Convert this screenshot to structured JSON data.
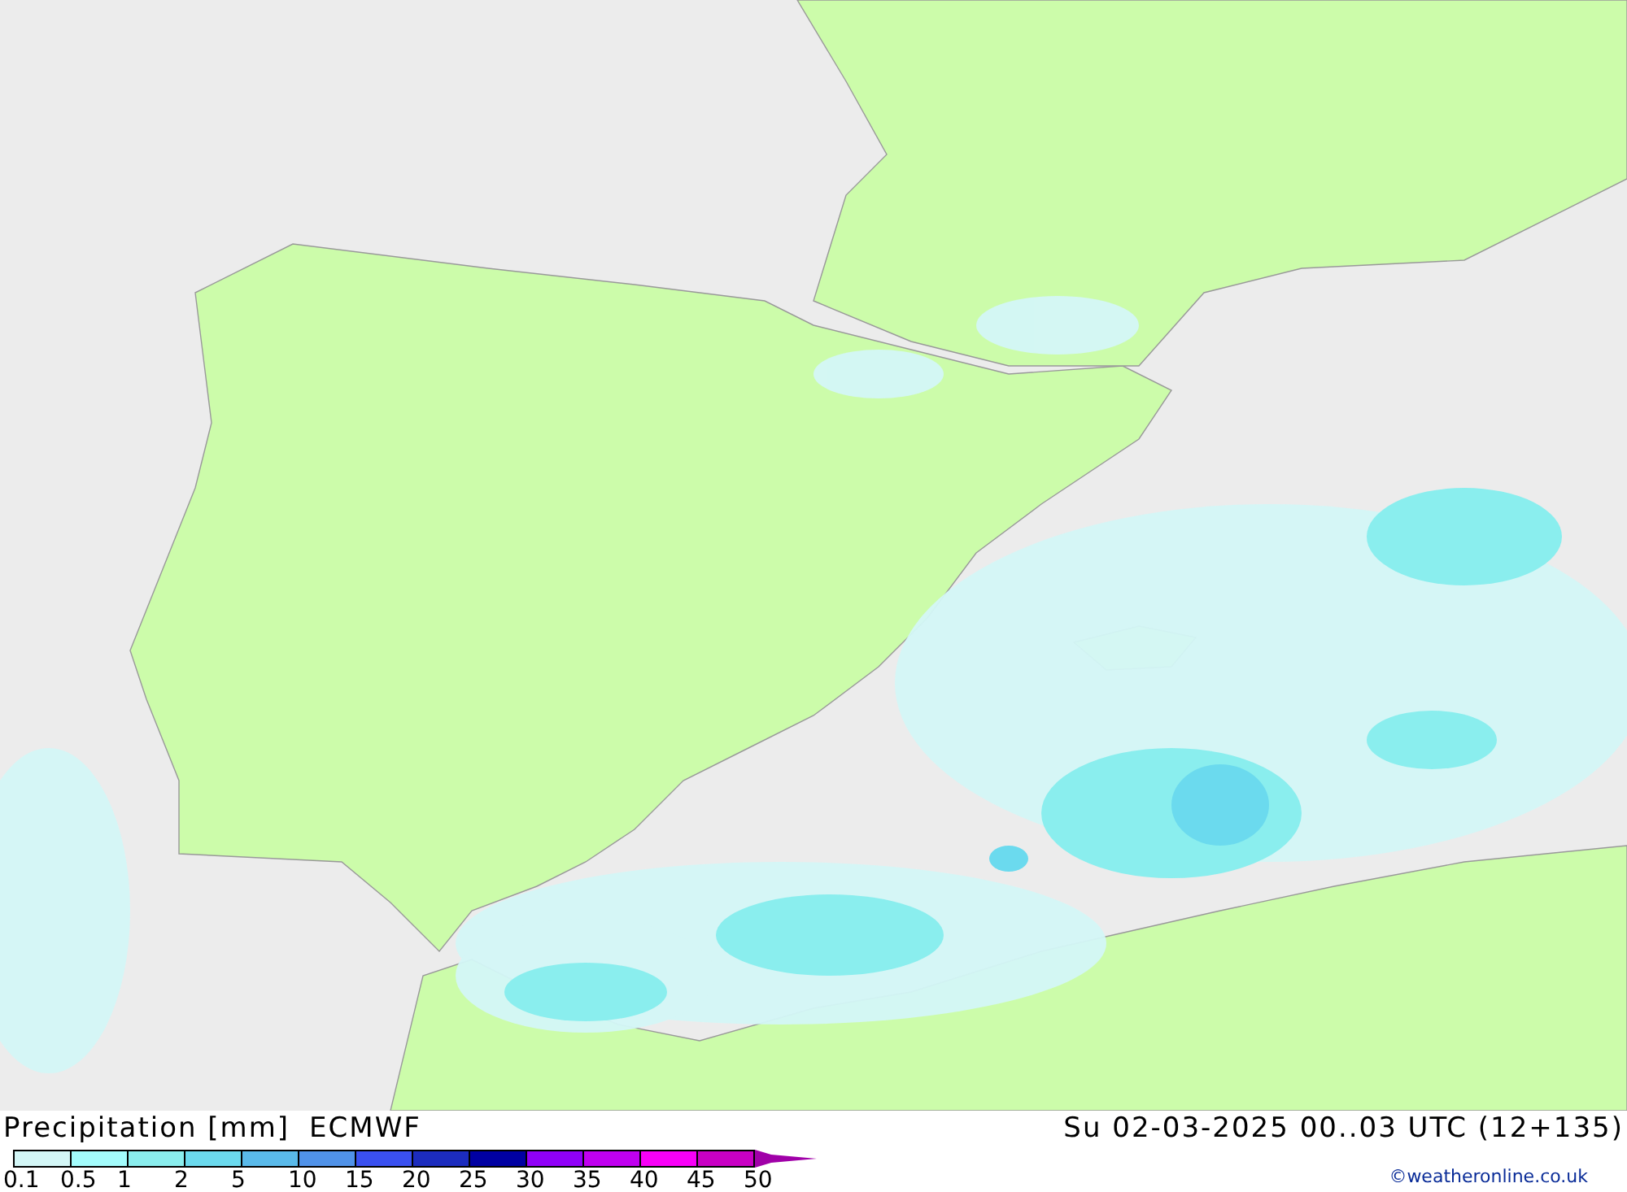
{
  "map": {
    "title": "Precipitation [mm]",
    "model": "ECMWF",
    "valid_time": "Su 02-03-2025 00..03 UTC (12+135)"
  },
  "legend": [
    {
      "label": "0.1",
      "color": "#d4f7f7"
    },
    {
      "label": "0.5",
      "color": "#a3fcfc"
    },
    {
      "label": "1",
      "color": "#8aeeee"
    },
    {
      "label": "2",
      "color": "#6bdaee"
    },
    {
      "label": "5",
      "color": "#5abaea"
    },
    {
      "label": "10",
      "color": "#5092e8"
    },
    {
      "label": "15",
      "color": "#3a50f0"
    },
    {
      "label": "20",
      "color": "#1c2cbe"
    },
    {
      "label": "25",
      "color": "#0000a2"
    },
    {
      "label": "30",
      "color": "#9000f8"
    },
    {
      "label": "35",
      "color": "#c000f0"
    },
    {
      "label": "40",
      "color": "#f800f8"
    },
    {
      "label": "45",
      "color": "#c800c4"
    },
    {
      "label": "50",
      "color": "#a000a8"
    }
  ],
  "credit": "©weatheronline.co.uk"
}
